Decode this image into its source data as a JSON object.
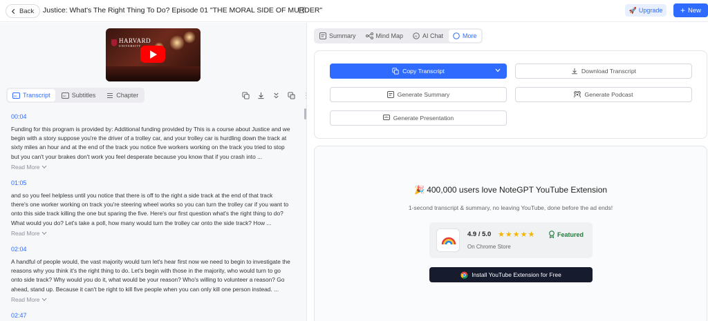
{
  "header": {
    "back_label": "Back",
    "title": "Justice: What's The Right Thing To Do? Episode 01 \"THE MORAL SIDE OF MURDER\"",
    "upgrade_label": "Upgrade",
    "new_label": "New"
  },
  "video": {
    "brand": "HARVARD",
    "brand_sub": "UNIVERSITY"
  },
  "left_tabs": [
    {
      "label": "Transcript",
      "icon": "cc-icon"
    },
    {
      "label": "Subtitles",
      "icon": "cc-icon"
    },
    {
      "label": "Chapter",
      "icon": "list-icon"
    }
  ],
  "segments": [
    {
      "time": "00:04",
      "text": "Funding for this program is provided by: Additional funding provided by This is a course about Justice and we begin with a story suppose you're the driver of a trolley car, and your trolley car is hurdling down the track at sixty miles an hour and at the end of the track you notice five workers working on the track you tried to stop but you can't your brakes don't work you feel desperate because you know that if you crash into ...",
      "more": "Read More"
    },
    {
      "time": "01:05",
      "text": "and so you feel helpless until you notice that there is off to the right a side track at the end of that track there's one worker working on track you're steering wheel works so you can turn the trolley car if you want to onto this side track killing the one but sparing the five. Here's our first question what's the right thing to do? What would you do? Let's take a poll, how many would turn the trolley car onto the side track? How ...",
      "more": "Read More"
    },
    {
      "time": "02:04",
      "text": "A handful of people would, the vast majority would turn let's hear first now we need to begin to investigate the reasons why you think it's the right thing to do. Let's begin with those in the majority, who would turn to go onto side track? Why would you do it, what would be your reason? Who's willing to volunteer a reason? Go ahead, stand up. Because it can't be right to kill five people when you can only kill one person instead. ...",
      "more": "Read More"
    },
    {
      "time": "02:47",
      "text": "",
      "more": ""
    }
  ],
  "right_tabs": [
    {
      "label": "Summary",
      "icon": "summary-icon"
    },
    {
      "label": "Mind Map",
      "icon": "mindmap-icon"
    },
    {
      "label": "AI Chat",
      "icon": "chat-icon"
    },
    {
      "label": "More",
      "icon": "circle-icon"
    }
  ],
  "actions": {
    "copy": "Copy Transcript",
    "download": "Download Transcript",
    "summary": "Generate Summary",
    "podcast": "Generate Podcast",
    "presentation": "Generate Presentation"
  },
  "promo": {
    "title": "🎉 400,000 users love NoteGPT YouTube Extension",
    "subtitle": "1-second transcript & summary, no leaving YouTube, done before the ad ends!",
    "rating": "4.9 / 5.0",
    "stars": "★★★★★",
    "featured": "Featured",
    "store": "On Chrome Store",
    "install": "Install YouTube Extension for Free"
  },
  "colors": {
    "accent": "#2f6bff",
    "install_bg": "#161b2e",
    "star": "#f5b400",
    "featured": "#1f7a3a"
  }
}
